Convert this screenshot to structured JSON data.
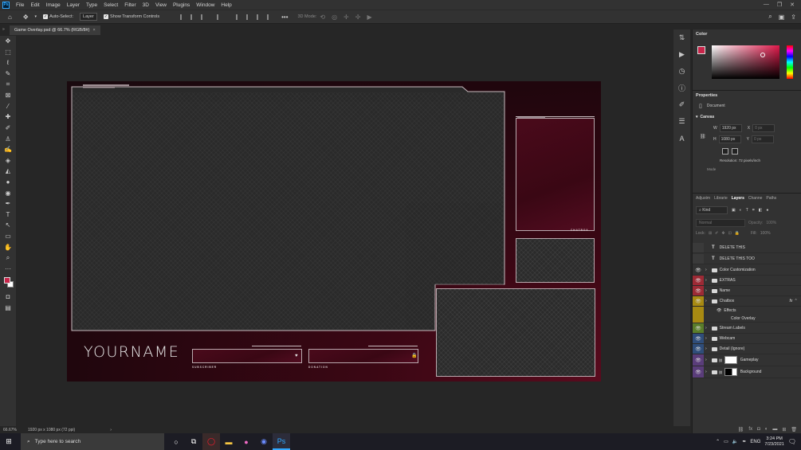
{
  "menubar": {
    "items": [
      "File",
      "Edit",
      "Image",
      "Layer",
      "Type",
      "Select",
      "Filter",
      "3D",
      "View",
      "Plugins",
      "Window",
      "Help"
    ]
  },
  "options": {
    "auto_select_label": "Auto-Select:",
    "auto_select_value": "Layer",
    "transform_label": "Show Transform Controls",
    "mode_3d": "3D Mode:"
  },
  "document": {
    "tab_title": "Game Overlay.psd @ 66.7% (RGB/8#)",
    "zoom": "66.67%",
    "size": "1920 px x 1080 px (72 ppi)"
  },
  "artboard": {
    "name": "YOURNAME",
    "subscriber_label": "SUBSCRIBER",
    "donation_label": "DONATION",
    "chatbox_label": "CHATBOX"
  },
  "panels": {
    "color_title": "Color",
    "properties_title": "Properties",
    "document_label": "Document",
    "canvas_title": "Canvas",
    "width": "1920 px",
    "height": "1080 px",
    "x_placeholder": "0 px",
    "y_placeholder": "0 px",
    "resolution": "Resolution: 72 pixels/inch",
    "mode_label": "Mode",
    "tabs": [
      "Adjustm",
      "Librarie",
      "Layers",
      "Channe",
      "Paths"
    ],
    "kind_label": "Kind",
    "blend_mode": "Normal",
    "opacity_label": "Opacity:",
    "opacity_value": "100%",
    "lock_label": "Lock:",
    "fill_label": "Fill:",
    "fill_value": "100%"
  },
  "layers": [
    {
      "name": "DELETE THIS",
      "type": "text",
      "color": "#323232",
      "visible": false
    },
    {
      "name": "DELETE THIS TOO",
      "type": "text",
      "color": "#323232",
      "visible": false
    },
    {
      "name": "Color Customization",
      "type": "group",
      "color": "#323232",
      "visible": true
    },
    {
      "name": "EXTRAS",
      "type": "group",
      "color": "#9c2a35",
      "visible": true
    },
    {
      "name": "Name",
      "type": "group",
      "color": "#9c2a35",
      "visible": true
    },
    {
      "name": "Chatbox",
      "type": "group",
      "color": "#a88a12",
      "visible": true
    },
    {
      "name": "Effects",
      "type": "effects",
      "color": "#a88a12",
      "visible": true
    },
    {
      "name": "Color Overlay",
      "type": "effect",
      "color": "#a88a12",
      "visible": true
    },
    {
      "name": "Stream Labels",
      "type": "group",
      "color": "#5a7d2a",
      "visible": true
    },
    {
      "name": "Webcam",
      "type": "group",
      "color": "#2f4d7a",
      "visible": true
    },
    {
      "name": "Detail (Ignore)",
      "type": "group",
      "color": "#2f4d7a",
      "visible": true
    },
    {
      "name": "Gameplay",
      "type": "group",
      "color": "#5a3d7a",
      "visible": true
    },
    {
      "name": "Background",
      "type": "group",
      "color": "#5a3d7a",
      "visible": true
    }
  ],
  "taskbar": {
    "search_placeholder": "Type here to search",
    "time": "3:24 PM",
    "date": "7/23/2021",
    "lang": "ENG"
  },
  "colors": {
    "foreground": "#c8254a",
    "background": "#ffffff",
    "accent": "#8c1030"
  }
}
